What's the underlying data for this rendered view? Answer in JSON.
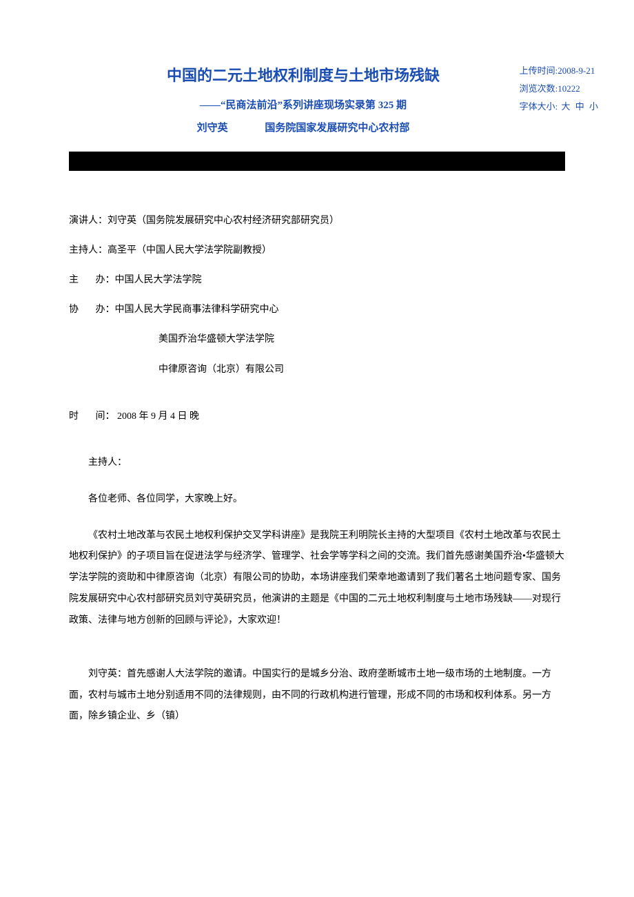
{
  "meta": {
    "upload_label": "上传时间:",
    "upload_value": "2008-9-21",
    "views_label": "浏览次数:",
    "views_value": "10222",
    "fontsize_label": "字体大小:",
    "fontsize_large": "大",
    "fontsize_medium": "中",
    "fontsize_small": "小"
  },
  "title": {
    "main": "中国的二元土地权利制度与土地市场残缺",
    "sub": "——“民商法前沿”系列讲座现场实录第 325 期",
    "author": "刘守英",
    "affiliation": "国务院国家发展研究中心农村部"
  },
  "info": {
    "speaker_label": "演讲人：",
    "speaker_value": "刘守英（国务院发展研究中心农村经济研究部研究员）",
    "host_label": "主持人：",
    "host_value": "高圣平（中国人民大学法学院副教授）",
    "organizer_label": "主",
    "organizer_label2": "办：",
    "organizer_value": "中国人民大学法学院",
    "co_organizer_label": "协",
    "co_organizer_label2": "办：",
    "co_organizer_value": "中国人民大学民商事法律科学研究中心",
    "co_organizer_value2": "美国乔治华盛顿大学法学院",
    "co_organizer_value3": "中律原咨询（北京）有限公司",
    "time_label": "时",
    "time_label2": "间：",
    "time_value": " 2008 年 9 月 4 日  晚"
  },
  "body": {
    "p1": "主持人：",
    "p2": "各位老师、各位同学，大家晚上好。",
    "p3": "《农村土地改革与农民土地权利保护交叉学科讲座》是我院王利明院长主持的大型项目《农村土地改革与农民土地权利保护》的子项目旨在促进法学与经济学、管理学、社会学等学科之间的交流。我们首先感谢美国乔治•华盛顿大学法学院的资助和中律原咨询（北京）有限公司的协助，本场讲座我们荣幸地邀请到了我们著名土地问题专家、国务院发展研究中心农村部研究员刘守英研究员，他演讲的主题是《中国的二元土地权利制度与土地市场残缺——对现行政策、法律与地方创新的回顾与评论》，大家欢迎！",
    "p4": "刘守英：首先感谢人大法学院的邀请。中国实行的是城乡分治、政府垄断城市土地一级市场的土地制度。一方面，农村与城市土地分别适用不同的法律规则，由不同的行政机构进行管理，形成不同的市场和权利体系。另一方面，除乡镇企业、乡（镇）"
  }
}
